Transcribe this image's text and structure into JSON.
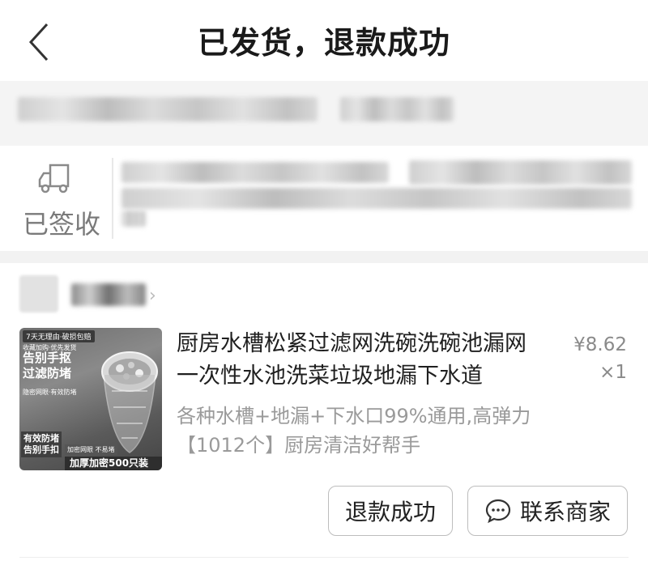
{
  "header": {
    "title": "已发货，退款成功",
    "back_icon": "chevron-left-icon"
  },
  "logistics": {
    "icon": "truck-icon",
    "status": "已签收"
  },
  "product": {
    "title": "厨房水槽松紧过滤网洗碗洗碗池漏网一次性水池洗菜垃圾地漏下水道",
    "spec": "各种水槽+地漏+下水口99%通用,高弹力【1012个】厨房清洁好帮手",
    "price": "¥8.62",
    "quantity": "×1",
    "image_text": {
      "top_badge": "7天无理由·破损包赔",
      "line_a": "收藏加购·优先发货",
      "big_line1": "告别手抠",
      "big_line2": "过滤防堵",
      "line_b": "隐密网眼·有效防堵",
      "foot_line1": "有效防堵",
      "foot_line2": "告别手扣",
      "foot_mid": "加密网眼 不易堵",
      "foot_banner": "加厚加密500只装"
    }
  },
  "actions": {
    "refund_label": "退款成功",
    "contact_label": "联系商家",
    "contact_icon": "chat-bubble-icon"
  }
}
